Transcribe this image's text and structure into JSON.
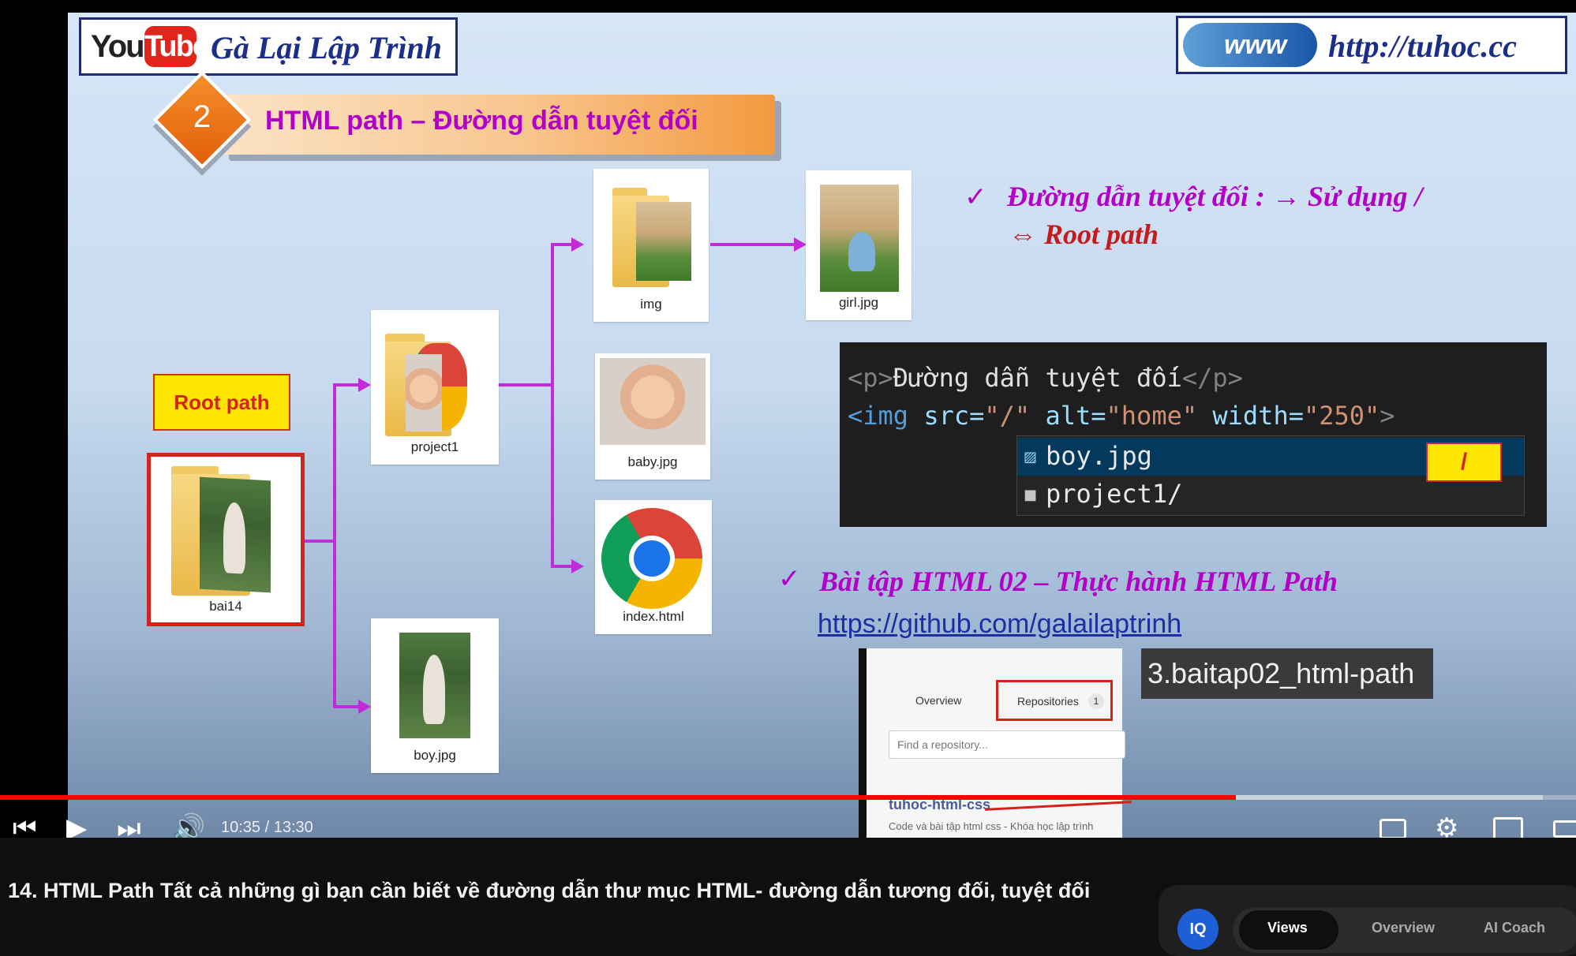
{
  "slide": {
    "youtube_you": "You",
    "youtube_tube": "Tube",
    "channel_name": "Gà Lại Lập Trình",
    "www": "www",
    "site_url": "http://tuhoc.cc",
    "section_number": "2",
    "section_title": "HTML path – Đường dẫn tuyệt đối",
    "root_label": "Root path",
    "files": {
      "bai14": "bai14",
      "project1": "project1",
      "img": "img",
      "girl": "girl.jpg",
      "baby": "baby.jpg",
      "index": "index.html",
      "boy": "boy.jpg"
    },
    "check_mark": "✓",
    "absolute_line1": "Đường dẫn tuyệt đối : → Sử dụng /",
    "absolute_line2": "⇔ Root path",
    "code": {
      "line1_open": "<p>",
      "line1_text": "Đường dẫn tuyệt đối",
      "line1_close": "</p>",
      "line2_tag": "<img",
      "line2_src_attr": " src=",
      "line2_src_val": "\"/\"",
      "line2_alt_attr": " alt=",
      "line2_alt_val": "\"home\"",
      "line2_width_attr": " width=",
      "line2_width_val": "\"250\"",
      "line2_end": ">",
      "suggestions": [
        "boy.jpg",
        "project1/"
      ],
      "slash_hint": "/"
    },
    "exercise_title": "Bài tập HTML 02 – Thực hành HTML Path",
    "github_link": "https://github.com/galailaptrinh",
    "github_panel": {
      "tab_overview": "Overview",
      "tab_repositories": "Repositories",
      "repo_count": "1",
      "find_placeholder": "Find a repository...",
      "repo_title": "tuhoc-html-css",
      "repo_desc": "Code và bài tập html css - Khóa học lập trình"
    },
    "repo_name": "3.baitap02_html-path"
  },
  "player": {
    "time_display": "10:35 / 13:30",
    "progress_fraction": 0.784,
    "icons": [
      "previous-icon",
      "play-icon",
      "next-icon",
      "volume-icon",
      "subtitles-icon",
      "settings-icon",
      "miniplayer-icon",
      "theater-icon"
    ]
  },
  "video": {
    "title": "14. HTML Path Tất cả những gì bạn cần biết về đường dẫn thư mục HTML- đường dẫn tương đối, tuyệt đối"
  },
  "side_panel": {
    "badge": "IQ",
    "tabs": [
      "Views",
      "Overview",
      "AI Coach"
    ]
  },
  "colors": {
    "progress": "#ff0000",
    "accent_purple": "#b200c8",
    "connector": "#c22bd8"
  }
}
